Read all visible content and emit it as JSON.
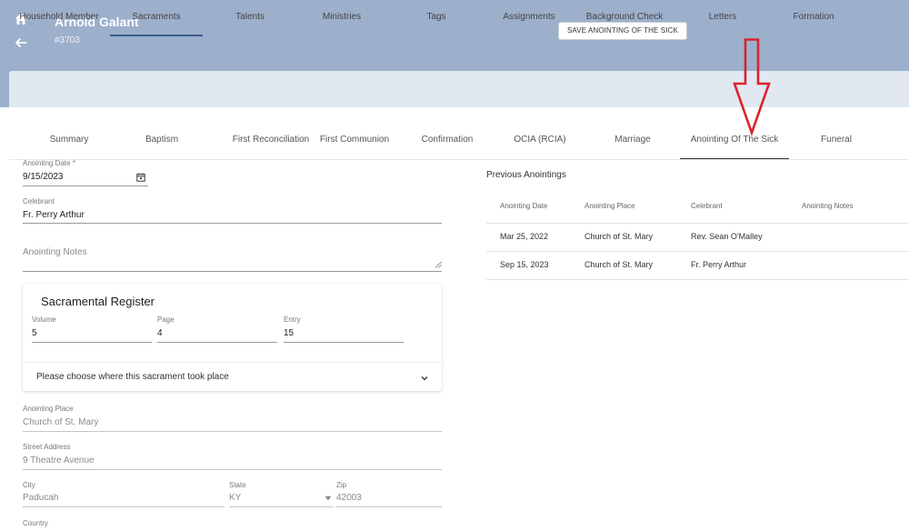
{
  "header": {
    "name": "Arnold Galant",
    "id": "#3703",
    "save_label": "SAVE ANOINTING OF THE SICK",
    "icons": [
      "home-icon",
      "arrow-left-icon"
    ]
  },
  "main_tabs": [
    {
      "label": "Household Member"
    },
    {
      "label": "Sacraments",
      "active": true
    },
    {
      "label": "Talents"
    },
    {
      "label": "Ministries"
    },
    {
      "label": "Tags"
    },
    {
      "label": "Assignments"
    },
    {
      "label": "Background Check"
    },
    {
      "label": "Letters"
    },
    {
      "label": "Formation"
    }
  ],
  "sub_tabs": [
    {
      "label": "Summary"
    },
    {
      "label": "Baptism"
    },
    {
      "label": "First Reconciliation"
    },
    {
      "label": "First Communion"
    },
    {
      "label": "Confirmation"
    },
    {
      "label": "OCIA (RCIA)"
    },
    {
      "label": "Marriage"
    },
    {
      "label": "Anointing Of The Sick",
      "active": true
    },
    {
      "label": "Funeral"
    }
  ],
  "form": {
    "date_label": "Anointing Date *",
    "date_value": "9/15/2023",
    "celebrant_label": "Celebrant",
    "celebrant_value": "Fr. Perry Arthur",
    "notes_placeholder": "Anointing Notes",
    "register": {
      "title": "Sacramental Register",
      "volume_label": "Volume",
      "volume_value": "5",
      "page_label": "Page",
      "page_value": "4",
      "entry_label": "Entry",
      "entry_value": "15",
      "place_select": "Please choose where this sacrament took place"
    },
    "place_label": "Anointing Place",
    "place_value": "Church of St. Mary",
    "street_label": "Street Address",
    "street_value": "9 Theatre Avenue",
    "city_label": "City",
    "city_value": "Paducah",
    "state_label": "State",
    "state_value": "KY",
    "zip_label": "Zip",
    "zip_value": "42003",
    "country_label": "Country"
  },
  "previous": {
    "title": "Previous Anointings",
    "columns": [
      "Anointing Date",
      "Anointing Place",
      "Celebrant",
      "Anointing Notes"
    ],
    "rows": [
      {
        "date": "Mar 25, 2022",
        "place": "Church of St. Mary",
        "celebrant": "Rev. Sean O'Malley",
        "notes": ""
      },
      {
        "date": "Sep 15, 2023",
        "place": "Church of St. Mary",
        "celebrant": "Fr. Perry Arthur",
        "notes": ""
      }
    ]
  },
  "colors": {
    "header_bg": "#9cb0cc",
    "tabbar_bg": "#e1e8f2",
    "annotation_arrow": "#d9232b"
  }
}
